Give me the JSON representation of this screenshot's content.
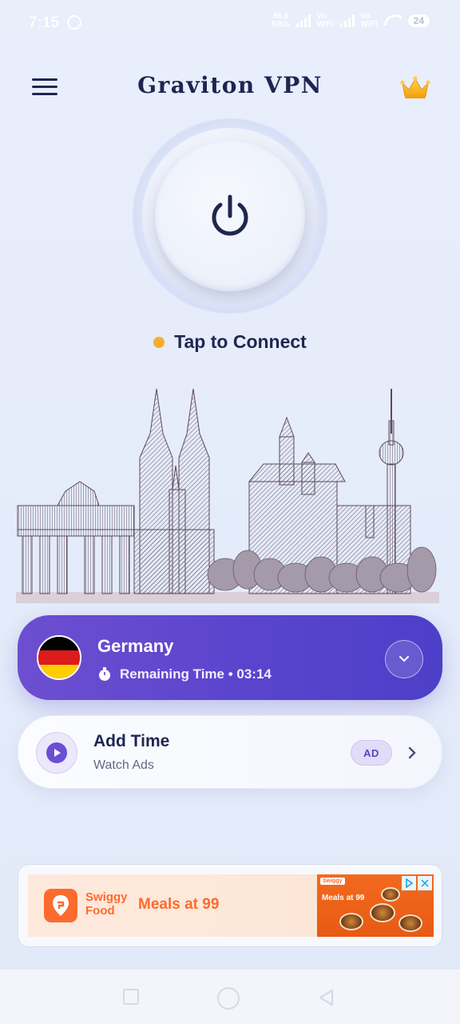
{
  "status_bar": {
    "time": "7:15",
    "net_speed_value": "86.0",
    "net_speed_unit": "KB/s",
    "volte1_top": "Vo",
    "volte1_bottom": "WiFi",
    "volte2_top": "Vo",
    "volte2_bottom": "WiFi",
    "battery": "24"
  },
  "header": {
    "title": "Graviton VPN"
  },
  "connection": {
    "status_text": "Tap to Connect",
    "status_color": "#f6ad2b"
  },
  "server": {
    "country": "Germany",
    "remaining_label": "Remaining Time • 03:14"
  },
  "add_time": {
    "title": "Add Time",
    "subtitle": "Watch Ads",
    "badge": "AD"
  },
  "ad": {
    "brand_line1": "Swiggy",
    "brand_line2": "Food",
    "headline": "Meals at 99",
    "image_logo": "Swiggy",
    "image_text": "Meals at 99"
  },
  "colors": {
    "accent": "#5a44cd",
    "title": "#1e2552",
    "swiggy": "#fc6b2d"
  }
}
